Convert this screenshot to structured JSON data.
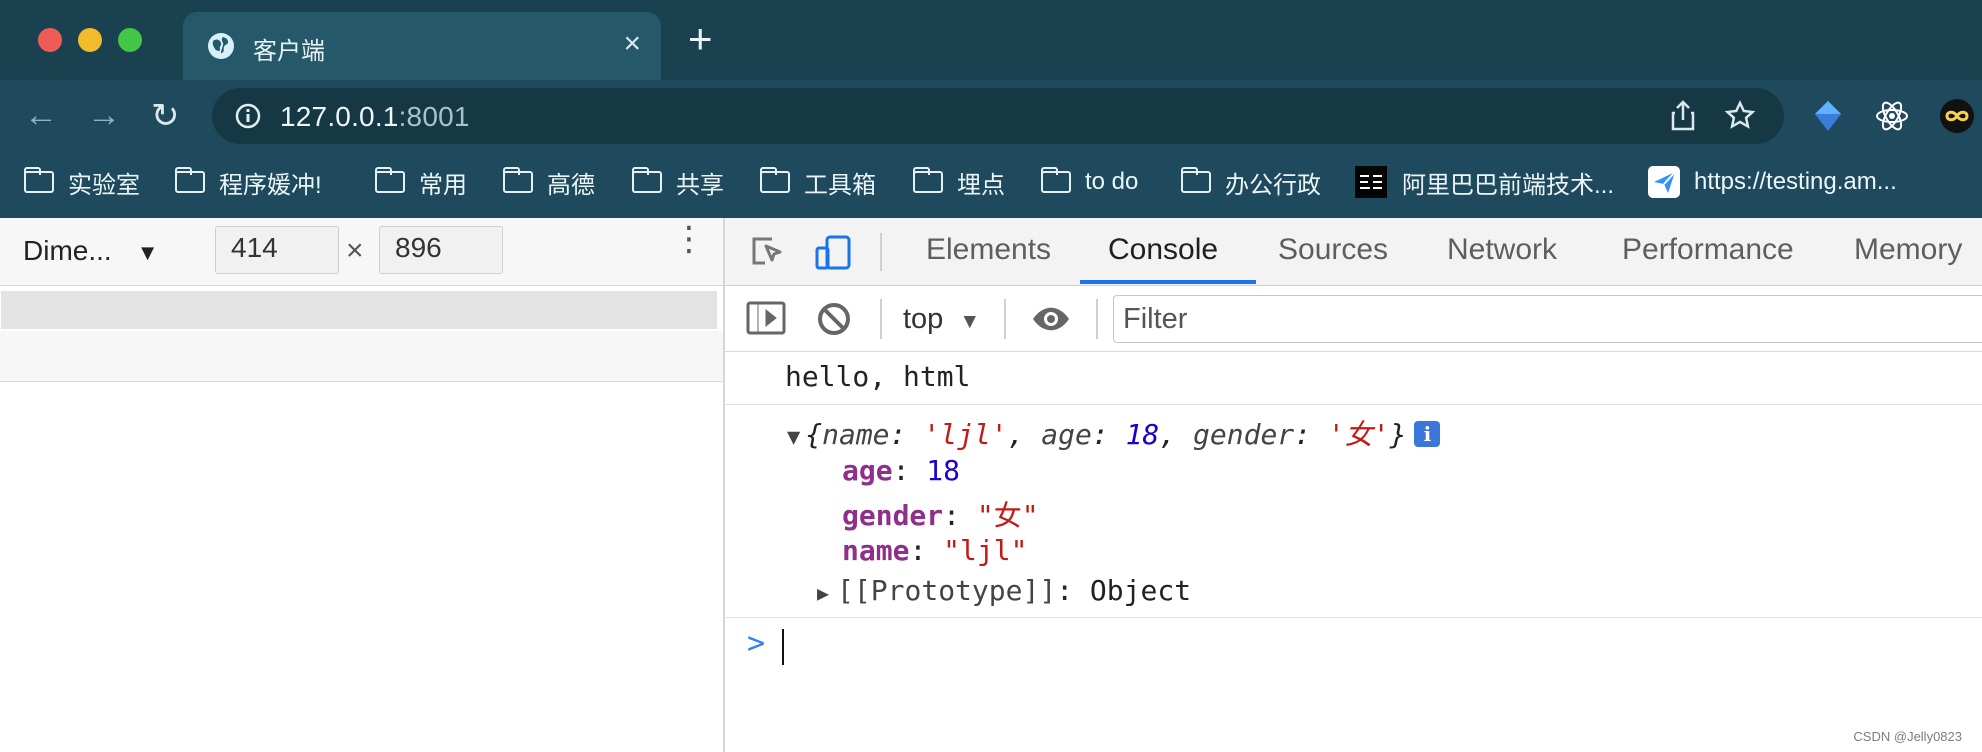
{
  "browser": {
    "tab_title": "客户端",
    "url_host": "127.0.0.1",
    "url_port": ":8001"
  },
  "bookmarks": [
    {
      "label": "实验室"
    },
    {
      "label": "程序媛冲!"
    },
    {
      "label": "常用"
    },
    {
      "label": "高德"
    },
    {
      "label": "共享"
    },
    {
      "label": "工具箱"
    },
    {
      "label": "埋点"
    },
    {
      "label": "to do"
    },
    {
      "label": "办公行政"
    },
    {
      "label": "阿里巴巴前端技术..."
    },
    {
      "label": "https://testing.am..."
    }
  ],
  "device": {
    "preset": "Dime...",
    "width": "414",
    "height": "896"
  },
  "devtools": {
    "tabs": [
      "Elements",
      "Console",
      "Sources",
      "Network",
      "Performance",
      "Memory"
    ],
    "context": "top",
    "filter_placeholder": "Filter"
  },
  "console": {
    "log": "hello, html",
    "object_preview": {
      "open": "{",
      "name_key": "name",
      "name_value": "'ljl'",
      "age_key": "age",
      "age_value": "18",
      "gender_key": "gender",
      "gender_value": "'女'",
      "close": "}"
    },
    "expanded": {
      "age_key": "age",
      "age_value": "18",
      "gender_key": "gender",
      "gender_value": "\"女\"",
      "name_key": "name",
      "name_value": "\"ljl\"",
      "prototype_label": "[[Prototype]]",
      "prototype_value": "Object"
    },
    "prompt": ">"
  },
  "watermark": "CSDN @Jelly0823",
  "colors": {
    "chrome_dark": "#1f4a5d",
    "active_tab": "#255869",
    "devtools_accent": "#1a73e8"
  }
}
